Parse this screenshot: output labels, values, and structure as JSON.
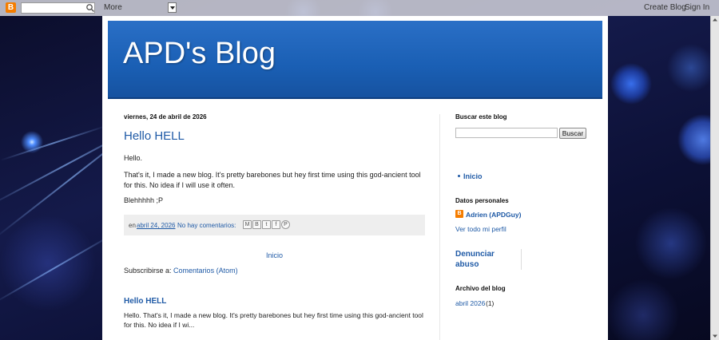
{
  "navbar": {
    "logo_glyph": "B",
    "search_value": "",
    "more_label": "More",
    "create_blog_label": "Create Blog",
    "sign_in_label": "Sign In"
  },
  "header": {
    "title": "APD's Blog"
  },
  "post": {
    "date": "viernes, 24 de abril de 2026",
    "title": "Hello HELL",
    "paragraphs": [
      " Hello.",
      "That's it, I made a new blog. It's pretty barebones but hey first time using this god-ancient tool for this. No idea if I will use it often.",
      "Blehhhhh ;P"
    ],
    "footer": {
      "prefix": "en",
      "date_link": "abril 24, 2026",
      "comments_link": "No hay comentarios:",
      "share_icons": [
        "M",
        "B",
        "t",
        "f",
        "P"
      ]
    }
  },
  "main": {
    "home_link": "Inicio",
    "subscribe_prefix": "Subscribirse a:",
    "subscribe_link": "Comentarios (Atom)",
    "related": {
      "title": "Hello HELL",
      "snippet": " Hello. That's it, I made a new blog. It's pretty barebones but hey first time using this god-ancient tool for this. No idea if I wi..."
    }
  },
  "sidebar": {
    "search_heading": "Buscar este blog",
    "search_value": "",
    "search_button": "Buscar",
    "pages": [
      "Inicio"
    ],
    "profile_heading": "Datos personales",
    "author_name": "Adrien (APDGuy)",
    "profile_link": "Ver todo mi perfil",
    "report_abuse": "Denunciar abuso",
    "archive_heading": "Archivo del blog",
    "archive_month": "abril 2026",
    "archive_count": "(1)"
  },
  "colors": {
    "header_blue": "#1a5fb4",
    "link_blue": "#1f5aa6",
    "blogger_orange": "#f57d00"
  }
}
